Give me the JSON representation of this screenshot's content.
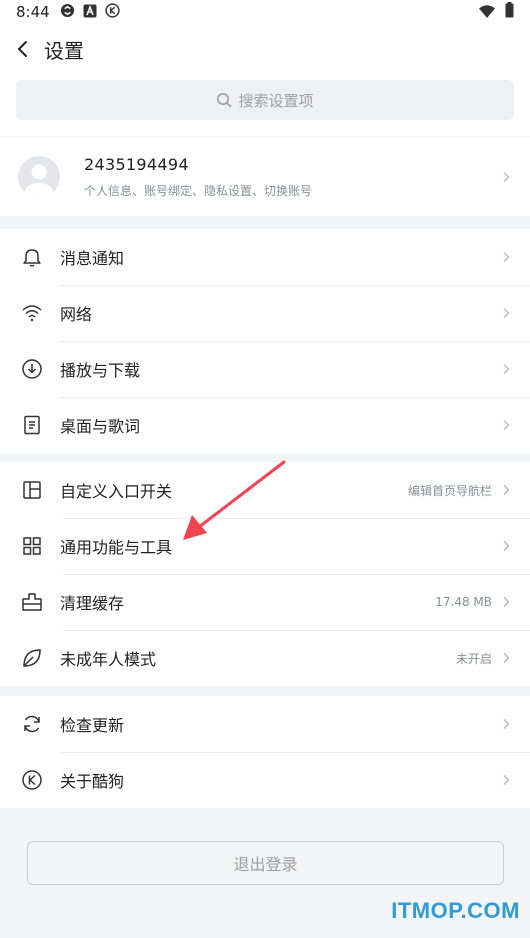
{
  "status_bar": {
    "time": "8:44",
    "left_icons": [
      "sync-icon",
      "a-badge-icon",
      "k-badge-icon"
    ],
    "right_icons": [
      "wifi-icon",
      "battery-icon"
    ]
  },
  "header": {
    "title": "设置",
    "back_icon": "chevron-left-icon"
  },
  "search": {
    "placeholder": "搜索设置项",
    "icon": "search-icon"
  },
  "profile": {
    "name": "2435194494",
    "description": "个人信息、账号绑定、隐私设置、切换账号"
  },
  "groups": [
    {
      "items": [
        {
          "label": "消息通知",
          "icon": "bell-icon"
        },
        {
          "label": "网络",
          "icon": "wifi-icon"
        },
        {
          "label": "播放与下载",
          "icon": "download-circle-icon"
        },
        {
          "label": "桌面与歌词",
          "icon": "document-icon"
        }
      ]
    },
    {
      "items": [
        {
          "label": "自定义入口开关",
          "icon": "layout-icon",
          "value": "编辑首页导航栏"
        },
        {
          "label": "通用功能与工具",
          "icon": "grid-icon"
        },
        {
          "label": "清理缓存",
          "icon": "broom-icon",
          "value": "17.48 MB"
        },
        {
          "label": "未成年人模式",
          "icon": "leaf-icon",
          "value": "未开启"
        }
      ]
    },
    {
      "items": [
        {
          "label": "检查更新",
          "icon": "refresh-icon"
        },
        {
          "label": "关于酷狗",
          "icon": "kugou-logo-icon"
        }
      ]
    }
  ],
  "logout": {
    "label": "退出登录"
  },
  "annotation": {
    "color": "#f0444f"
  },
  "watermark": {
    "text": "ITMOP.COM",
    "color": "#2f9bd8"
  }
}
